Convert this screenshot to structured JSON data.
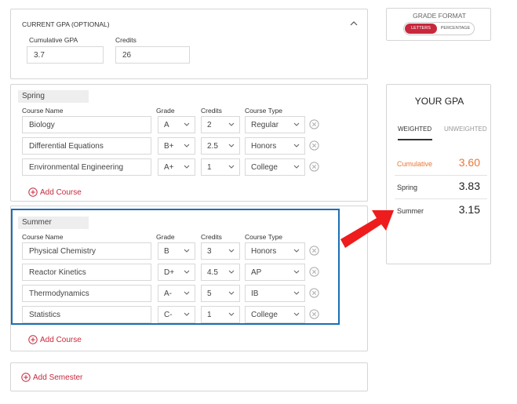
{
  "current_gpa": {
    "title": "CURRENT GPA (OPTIONAL)",
    "cumulative_label": "Cumulative GPA",
    "cumulative_value": "3.7",
    "credits_label": "Credits",
    "credits_value": "26"
  },
  "columns": {
    "course_name": "Course Name",
    "grade": "Grade",
    "credits": "Credits",
    "course_type": "Course Type"
  },
  "semesters": [
    {
      "name": "Spring",
      "courses": [
        {
          "name": "Biology",
          "grade": "A",
          "credits": "2",
          "type": "Regular"
        },
        {
          "name": "Differential Equations",
          "grade": "B+",
          "credits": "2.5",
          "type": "Honors"
        },
        {
          "name": "Environmental Engineering",
          "grade": "A+",
          "credits": "1",
          "type": "College"
        }
      ],
      "add_course": "Add Course"
    },
    {
      "name": "Summer",
      "courses": [
        {
          "name": "Physical Chemistry",
          "grade": "B",
          "credits": "3",
          "type": "Honors"
        },
        {
          "name": "Reactor Kinetics",
          "grade": "D+",
          "credits": "4.5",
          "type": "AP"
        },
        {
          "name": "Thermodynamics",
          "grade": "A-",
          "credits": "5",
          "type": "IB"
        },
        {
          "name": "Statistics",
          "grade": "C-",
          "credits": "1",
          "type": "College"
        }
      ],
      "add_course": "Add Course"
    }
  ],
  "add_semester": "Add Semester",
  "grade_format": {
    "title": "GRADE FORMAT",
    "options": [
      "LETTERS",
      "PERCENTAGE"
    ],
    "selected": "LETTERS"
  },
  "your_gpa": {
    "title": "YOUR GPA",
    "tabs": [
      "WEIGHTED",
      "UNWEIGHTED"
    ],
    "active_tab": "WEIGHTED",
    "rows": [
      {
        "label": "Cumulative",
        "value": "3.60"
      },
      {
        "label": "Spring",
        "value": "3.83"
      },
      {
        "label": "Summer",
        "value": "3.15"
      }
    ]
  },
  "colors": {
    "accent": "#c8283c",
    "cumulative_orange": "#e8773a",
    "highlight_blue": "#1a6fb5",
    "arrow_red": "#ee1c1c"
  }
}
